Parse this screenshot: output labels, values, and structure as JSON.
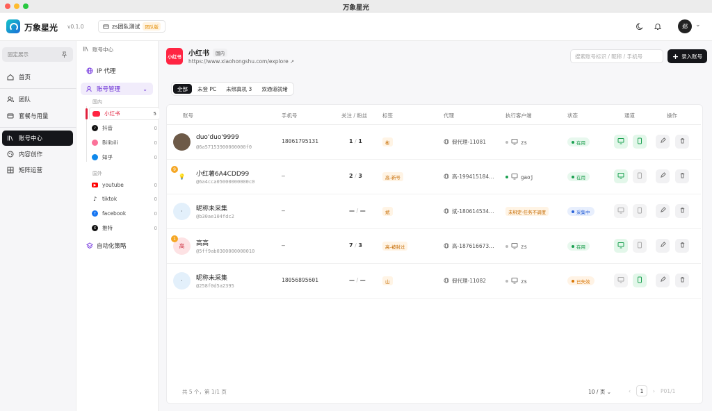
{
  "window": {
    "title": "万象星光"
  },
  "header": {
    "app_name": "万象星光",
    "version": "v0.1.0",
    "team_name": "zs团队测试",
    "team_badge": "团队版",
    "avatar_text": "郑"
  },
  "leftnav": {
    "pin_label": "固定展示",
    "items": [
      {
        "label": "首页",
        "icon": "home-icon"
      },
      {
        "label": "团队",
        "icon": "team-icon"
      },
      {
        "label": "套餐与用量",
        "icon": "card-icon"
      },
      {
        "label": "账号中心",
        "icon": "library-icon",
        "active": true
      },
      {
        "label": "内容创作",
        "icon": "palette-icon"
      },
      {
        "label": "矩阵运营",
        "icon": "grid-icon"
      }
    ]
  },
  "subnav": {
    "title": "账号中心",
    "ip_proxy": "IP 代理",
    "account_mgmt": "账号管理",
    "domestic_label": "国内",
    "foreign_label": "国外",
    "automation": "自动化策略",
    "domestic": [
      {
        "name": "小红书",
        "count": "5",
        "color": "#ff2442",
        "active": true
      },
      {
        "name": "抖音",
        "count": "0",
        "color": "#111111"
      },
      {
        "name": "Bilibili",
        "count": "0",
        "color": "#fb7299"
      },
      {
        "name": "知乎",
        "count": "0",
        "color": "#0f88eb"
      }
    ],
    "foreign": [
      {
        "name": "youtube",
        "count": "0",
        "color": "#ff0000"
      },
      {
        "name": "tiktok",
        "count": "0",
        "color": "#111111"
      },
      {
        "name": "facebook",
        "count": "0",
        "color": "#1877f2"
      },
      {
        "name": "推特",
        "count": "0",
        "color": "#111111"
      }
    ]
  },
  "platform": {
    "logo_text": "小红书",
    "name": "小红书",
    "region": "国内",
    "url": "https://www.xiaohongshu.com/explore"
  },
  "search": {
    "placeholder": "搜索账号标识 / 昵称 / 手机号"
  },
  "add_button": "录入账号",
  "tabs": [
    "全部",
    "未登 PC",
    "未绑真机 3",
    "双通道就绪"
  ],
  "columns": {
    "account": "账号",
    "phone": "手机号",
    "follow": "关注 / 粉丝",
    "tag": "标签",
    "proxy": "代理",
    "client": "执行客户端",
    "status": "状态",
    "channel": "通道",
    "ops": "操作"
  },
  "rows": [
    {
      "name": "duo'duo'9999",
      "id": "@6a57153900000000f0",
      "phone": "18061795131",
      "follow": "1",
      "fans": "1",
      "tag": "彬",
      "proxy": "假代理-11081",
      "client": "zs",
      "client_online": false,
      "status": "在用",
      "status_kind": "green",
      "avatar_text": "",
      "avatar_bg": "#6d5a48",
      "badge": "",
      "pc_on": true,
      "phone_on": true
    },
    {
      "name": "小红薯6A4CDD99",
      "id": "@6a4cca05000000000c0",
      "phone": "–",
      "follow": "2",
      "fans": "3",
      "tag": "高-新号",
      "proxy": "高-199415184…",
      "client": "gaoj",
      "client_online": true,
      "status": "在用",
      "status_kind": "green",
      "avatar_text": "💡",
      "avatar_bg": "#ffffff",
      "badge": "9",
      "pc_on": true,
      "phone_on": false
    },
    {
      "name": "昵称未采集",
      "id": "@b30ae104fdc2",
      "phone": "–",
      "follow": "—",
      "fans": "—",
      "tag": "斌",
      "proxy": "斌-180614534…",
      "client": "未绑定·任务不调度",
      "client_online": false,
      "status": "采集中",
      "status_kind": "blue",
      "avatar_text": "·",
      "avatar_bg": "#e3f0fb",
      "badge": "",
      "pc_on": false,
      "phone_on": false
    },
    {
      "name": "高高",
      "id": "@5ff9ab0300000000010",
      "phone": "–",
      "follow": "7",
      "fans": "3",
      "tag": "高-被封过",
      "proxy": "高-187616673…",
      "client": "zs",
      "client_online": false,
      "status": "在用",
      "status_kind": "green",
      "avatar_text": "高",
      "avatar_bg": "#fde2e4",
      "badge": "1",
      "pc_on": true,
      "phone_on": false
    },
    {
      "name": "昵称未采集",
      "id": "@258f0d5a2395",
      "phone": "18056895601",
      "follow": "—",
      "fans": "—",
      "tag": "山",
      "proxy": "假代理-11082",
      "client": "zs",
      "client_online": false,
      "status": "已失效",
      "status_kind": "orange",
      "avatar_text": "·",
      "avatar_bg": "#e3f0fb",
      "badge": "",
      "pc_on": false,
      "phone_on": true
    }
  ],
  "footer": {
    "summary": "共 5 个，第 1/1 页",
    "page_size": "10 / 页",
    "current_page": "1",
    "page_info": "P01/1"
  }
}
